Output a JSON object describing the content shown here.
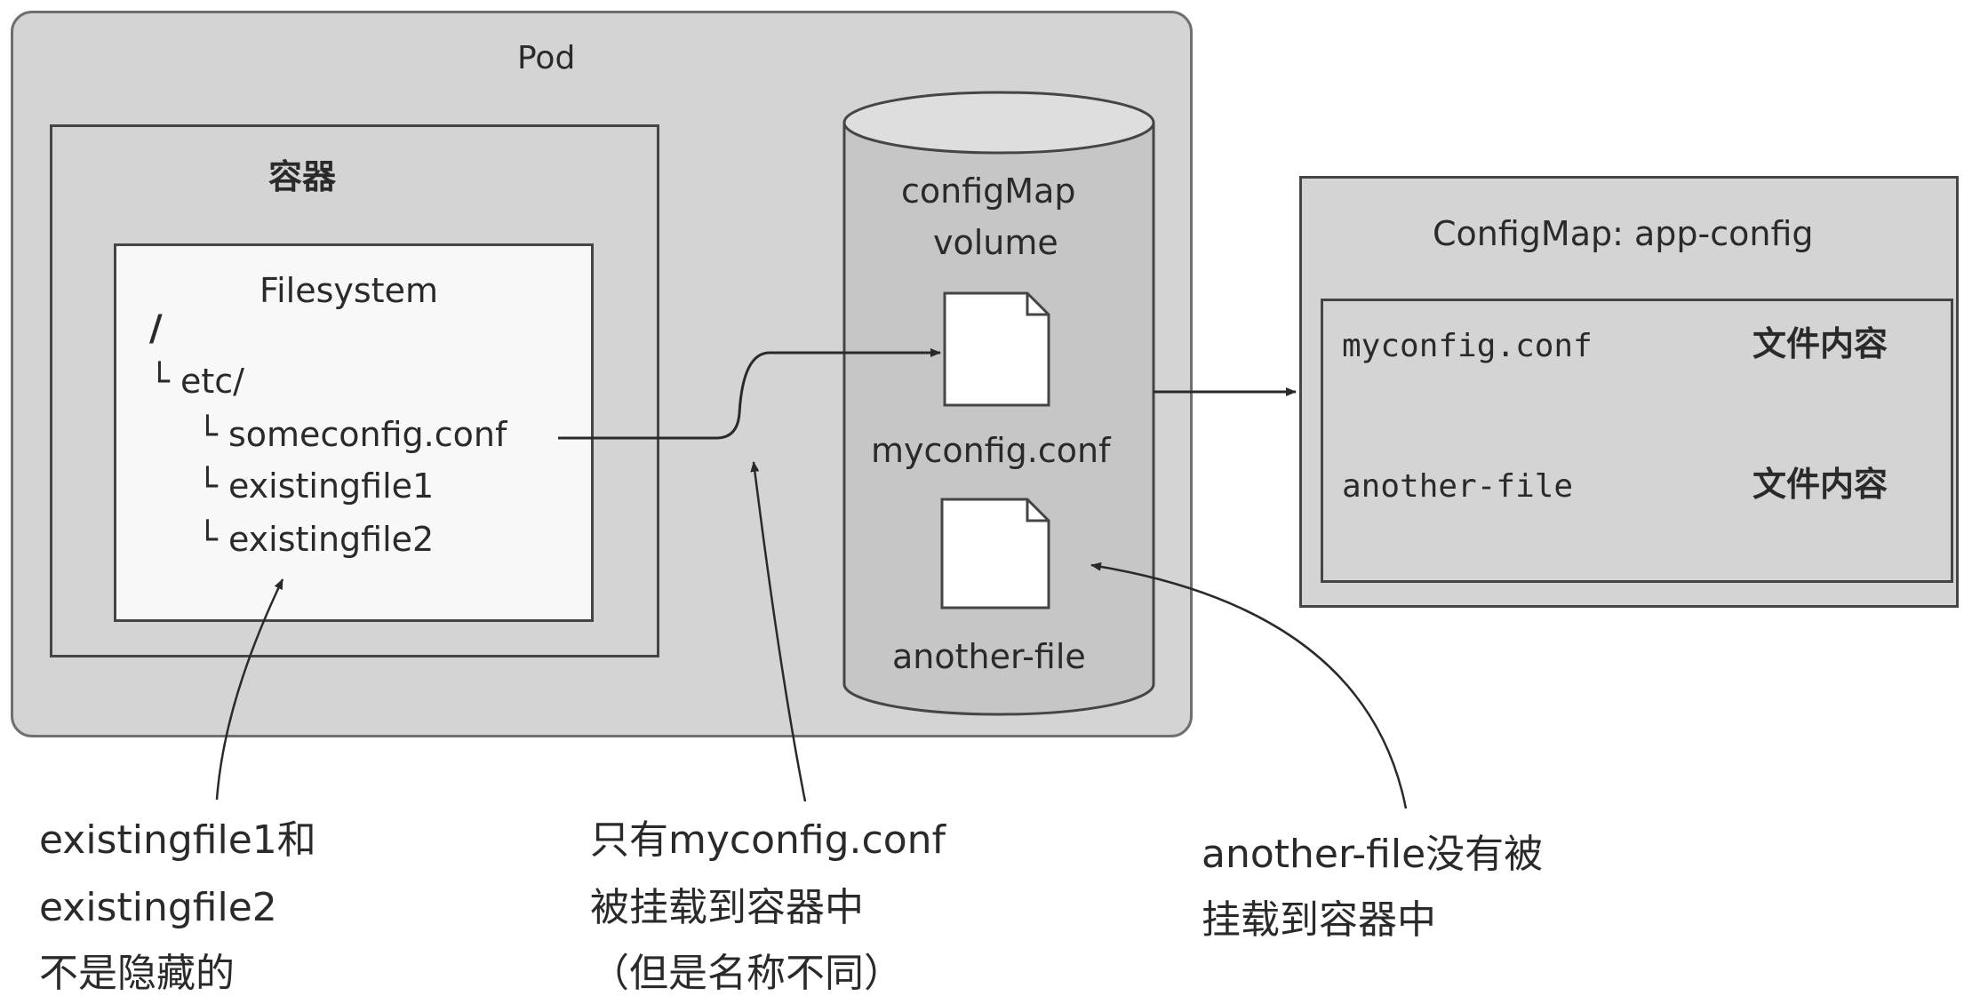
{
  "pod": {
    "label": "Pod"
  },
  "container": {
    "label": "容器",
    "filesystem": {
      "title": "Filesystem",
      "root": "/",
      "etc": "└ etc/",
      "files": [
        "└ someconfig.conf",
        "└ existingfile1",
        "└ existingfile2"
      ]
    }
  },
  "volume": {
    "label_line1": "configMap",
    "label_line2": "volume",
    "files": [
      "myconfig.conf",
      "another-file"
    ]
  },
  "configmap": {
    "title": "ConfigMap: app-config",
    "rows": [
      {
        "key": "myconfig.conf",
        "value": "文件内容"
      },
      {
        "key": "another-file",
        "value": "文件内容"
      }
    ]
  },
  "annotations": {
    "left": [
      "existingfile1和",
      "existingfile2",
      "不是隐藏的"
    ],
    "middle": [
      "只有myconfig.conf",
      "被挂载到容器中",
      "（但是名称不同）"
    ],
    "right": [
      "another-file没有被",
      "挂载到容器中"
    ]
  },
  "colors": {
    "pod_fill": "#d4d4d4",
    "fs_fill": "#f8f8f8",
    "border": "#454545"
  }
}
